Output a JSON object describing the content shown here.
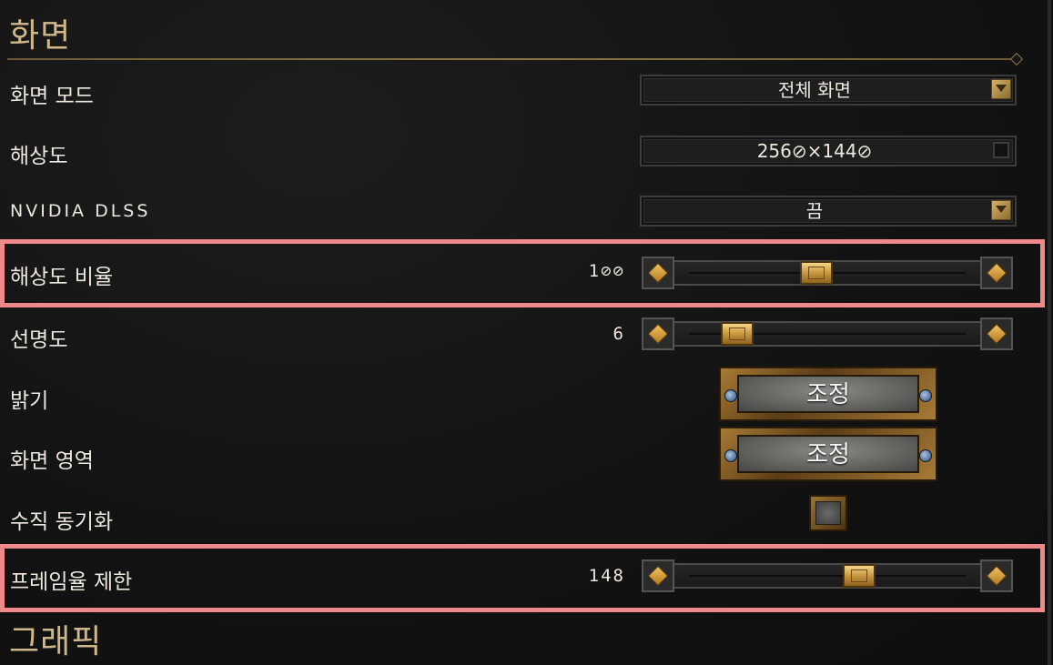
{
  "sections": {
    "display_title": "화면",
    "graphics_title": "그래픽"
  },
  "rows": {
    "display_mode": {
      "label": "화면 모드",
      "value": "전체 화면"
    },
    "resolution": {
      "label": "해상도",
      "value": "256⊘×144⊘"
    },
    "dlss": {
      "label": "NVIDIA DLSS",
      "value": "끔"
    },
    "resolution_scale": {
      "label": "해상도 비율",
      "value": "1⊘⊘",
      "level": 0.45
    },
    "sharpness": {
      "label": "선명도",
      "value": "6",
      "level": 0.1
    },
    "brightness": {
      "label": "밝기",
      "button": "조정"
    },
    "screen_area": {
      "label": "화면 영역",
      "button": "조정"
    },
    "vsync": {
      "label": "수직 동기화",
      "checked": false
    },
    "frame_limit": {
      "label": "프레임율 제한",
      "value": "148",
      "level": 0.64
    }
  },
  "colors": {
    "highlight": "#f08a8a",
    "title_gold": "#cfb78c"
  }
}
